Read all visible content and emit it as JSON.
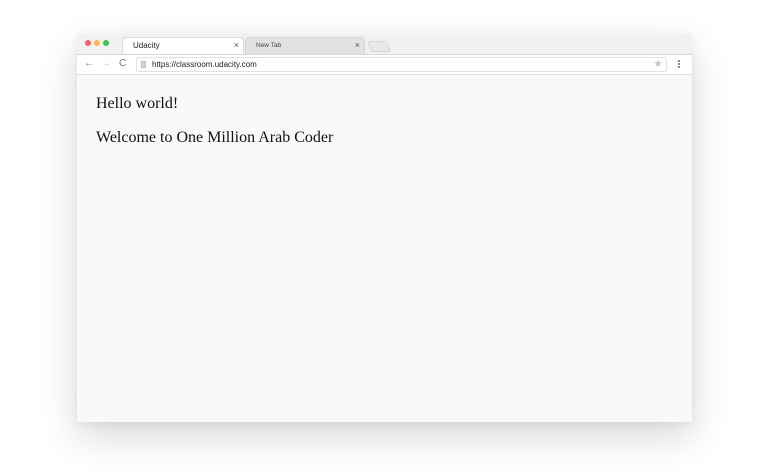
{
  "browser": {
    "tabs": [
      {
        "title": "Udacity",
        "close_label": "×",
        "active": true
      },
      {
        "title": "New Tab",
        "close_label": "×",
        "active": false
      }
    ],
    "toolbar": {
      "back_icon": "←",
      "forward_icon": "→",
      "reload_icon": "C",
      "url": "https://classroom.udacity.com",
      "star_icon": "★"
    }
  },
  "page": {
    "lines": [
      "Hello world!",
      "Welcome to One Million Arab Coder"
    ]
  },
  "colors": {
    "traffic_red": "#fc605c",
    "traffic_yellow": "#fdbc40",
    "traffic_green": "#34c84a",
    "page_background": "#f8f9fb"
  }
}
